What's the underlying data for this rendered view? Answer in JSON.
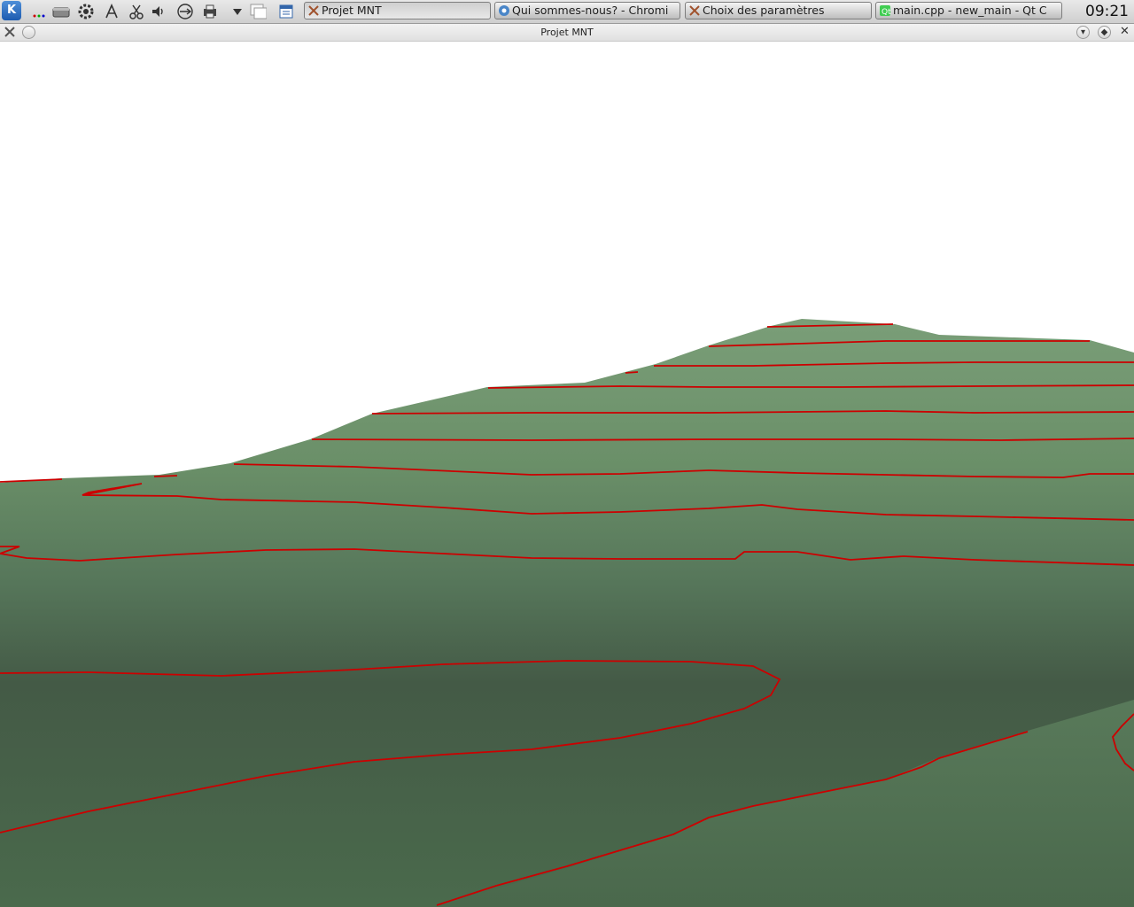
{
  "taskbar": {
    "start_icon": "kde-menu-icon",
    "tray_icons": [
      "more-dots-icon",
      "drive-icon",
      "settings-icon",
      "network-icon",
      "scissors-icon",
      "volume-icon",
      "usb-icon",
      "printer-icon",
      "dropdown-arrow-icon",
      "windows-icon",
      "calendar-icon"
    ],
    "tasks": [
      {
        "label": "Projet MNT",
        "icon": "xray-app-icon",
        "active": true
      },
      {
        "label": "Qui sommes-nous? - Chromi",
        "icon": "chromium-icon",
        "active": false
      },
      {
        "label": "Choix des paramètres",
        "icon": "xray-app-icon",
        "active": false
      },
      {
        "label": "main.cpp - new_main - Qt C",
        "icon": "qt-creator-icon",
        "active": false
      }
    ],
    "clock": "09:21"
  },
  "window": {
    "title": "Projet MNT",
    "menu_icon": "window-menu-icon",
    "buttons": [
      "minimize-icon",
      "maximize-icon",
      "close-icon"
    ]
  },
  "scene": {
    "sky_color": "#ffffff",
    "terrain_light_color": "#7a9e78",
    "terrain_dark_color": "#3e5440",
    "contour_color": "#cc0000"
  }
}
